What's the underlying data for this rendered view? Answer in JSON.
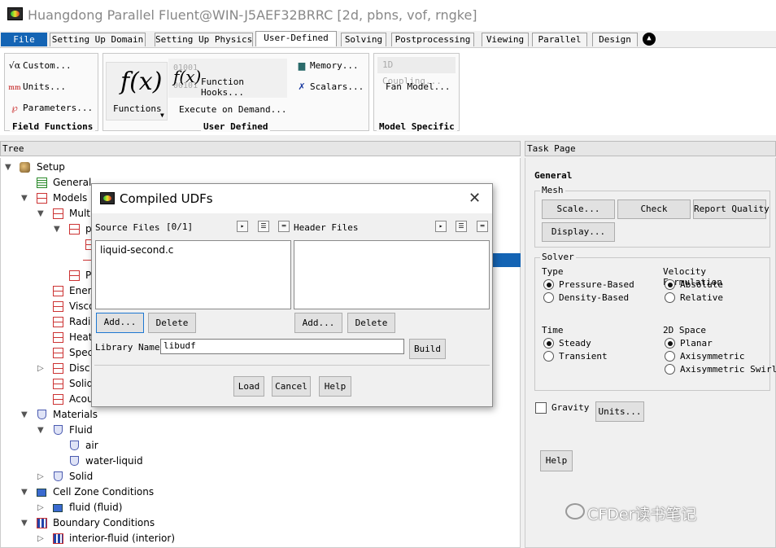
{
  "window": {
    "title": "Huangdong Parallel Fluent@WIN-J5AEF32BRRC  [2d, pbns, vof, rngke]"
  },
  "menu": {
    "tabs": [
      "File",
      "Setting Up Domain",
      "Setting Up Physics",
      "User-Defined",
      "Solving",
      "Postprocessing",
      "Viewing",
      "Parallel",
      "Design"
    ],
    "active": "User-Defined",
    "collapse_glyph": "▲"
  },
  "ribbon": {
    "field_functions": {
      "label": "Field Functions",
      "custom": "Custom...",
      "units": "Units...",
      "parameters": "Parameters..."
    },
    "user_defined": {
      "label": "User Defined",
      "functions": "Functions",
      "function_hooks": "Function Hooks...",
      "execute_on_demand": "Execute on Demand...",
      "memory": "Memory...",
      "scalars": "Scalars...",
      "hook_digits_1": "01001",
      "hook_digits_2": "00101"
    },
    "model_specific": {
      "label": "Model Specific",
      "coupling": "1D Coupling...",
      "fan_model": "Fan Model..."
    }
  },
  "tree": {
    "header": "Tree",
    "nodes": {
      "setup": "Setup",
      "general": "General",
      "models": "Models",
      "multiphase": "Multi",
      "p1": "p",
      "p2": "P",
      "energy": "Ener",
      "viscous": "Visco",
      "radiation": "Radi",
      "heat": "Heat",
      "species": "Spec",
      "discrete": "Disc",
      "solid": "Solid",
      "acoustics": "Acou",
      "materials": "Materials",
      "fluid": "Fluid",
      "air": "air",
      "water_liquid": "water-liquid",
      "mat_solid": "Solid",
      "cell_zone": "Cell Zone Conditions",
      "fluid_zone": "fluid (fluid)",
      "boundary": "Boundary Conditions",
      "interior": "interior-fluid (interior)"
    }
  },
  "task": {
    "header": "Task Page",
    "section": "General",
    "mesh": {
      "legend": "Mesh",
      "scale": "Scale...",
      "check": "Check",
      "report_quality": "Report Quality",
      "display": "Display..."
    },
    "solver": {
      "legend": "Solver",
      "type_label": "Type",
      "pressure_based": "Pressure-Based",
      "density_based": "Density-Based",
      "type_selected": "Pressure-Based",
      "velocity_label": "Velocity Formulation",
      "absolute": "Absolute",
      "relative": "Relative",
      "velocity_selected": "Absolute",
      "time_label": "Time",
      "steady": "Steady",
      "transient": "Transient",
      "time_selected": "Steady",
      "space_label": "2D Space",
      "planar": "Planar",
      "axisymmetric": "Axisymmetric",
      "axisymmetric_swirl": "Axisymmetric Swirl",
      "space_selected": "Planar"
    },
    "gravity": "Gravity",
    "gravity_checked": false,
    "units": "Units...",
    "help": "Help"
  },
  "dialog": {
    "title": "Compiled UDFs",
    "close_glyph": "✕",
    "source_label": "Source Files",
    "source_count": "[0/1]",
    "header_label": "Header Files",
    "source_files": [
      "liquid-second.c"
    ],
    "add": "Add...",
    "delete": "Delete",
    "library_label": "Library Name",
    "library_value": "libudf",
    "build": "Build",
    "load": "Load",
    "cancel": "Cancel",
    "help": "Help"
  },
  "watermark": "CFDer读书笔记",
  "colors": {
    "accent": "#1464b4"
  }
}
